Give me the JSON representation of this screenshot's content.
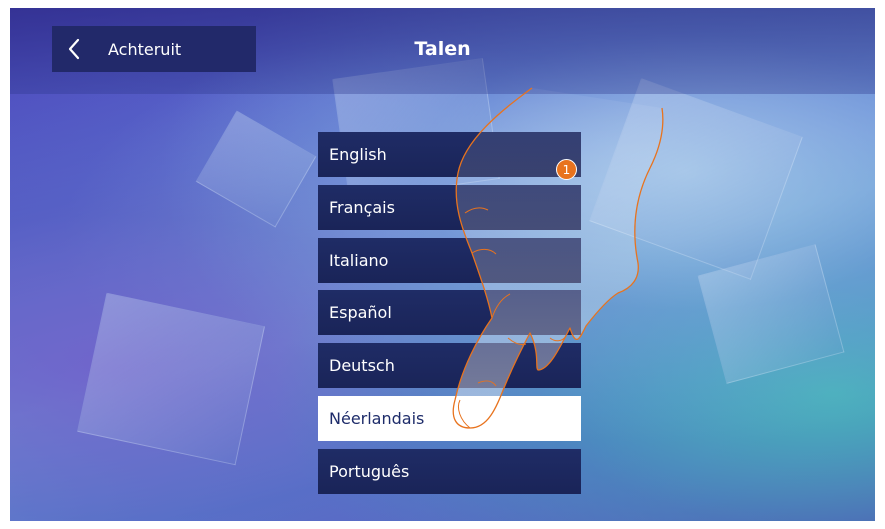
{
  "header": {
    "title": "Talen",
    "back_label": "Achteruit",
    "back_icon": "chevron-left-icon"
  },
  "languages": [
    {
      "label": "English",
      "selected": false
    },
    {
      "label": "Français",
      "selected": false
    },
    {
      "label": "Italiano",
      "selected": false
    },
    {
      "label": "Español",
      "selected": false
    },
    {
      "label": "Deutsch",
      "selected": false
    },
    {
      "label": "Néerlandais",
      "selected": true
    },
    {
      "label": "Português",
      "selected": false
    }
  ],
  "callout": {
    "number": "1",
    "color": "#e8731e"
  },
  "colors": {
    "button_bg": "#1f2c66",
    "selected_bg": "#ffffff",
    "selected_text": "#1e2c6a",
    "hand_outline": "#e8731e"
  }
}
